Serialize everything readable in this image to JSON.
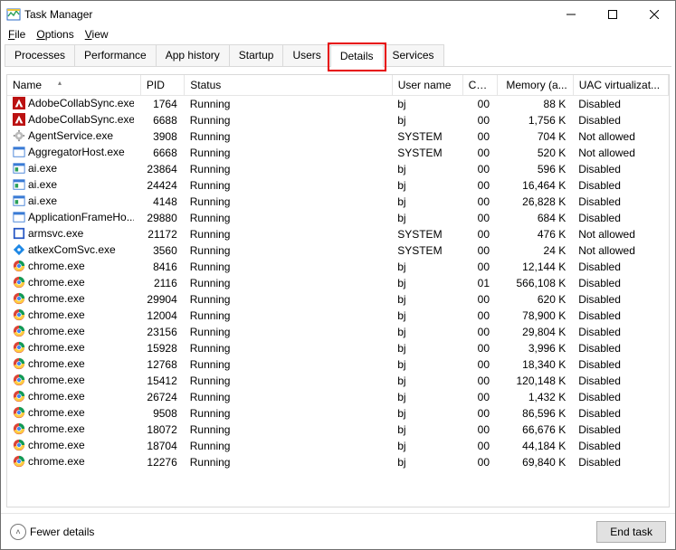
{
  "window": {
    "title": "Task Manager"
  },
  "menu": {
    "file": "File",
    "options": "Options",
    "view": "View"
  },
  "tabs": {
    "processes": "Processes",
    "performance": "Performance",
    "app_history": "App history",
    "startup": "Startup",
    "users": "Users",
    "details": "Details",
    "services": "Services"
  },
  "columns": {
    "name": "Name",
    "pid": "PID",
    "status": "Status",
    "user": "User name",
    "cpu": "CPU",
    "mem": "Memory (a...",
    "uac": "UAC virtualizat..."
  },
  "footer": {
    "fewer": "Fewer details",
    "endtask": "End task"
  },
  "processes": [
    {
      "icon": "adobe",
      "name": "AdobeCollabSync.exe",
      "pid": "1764",
      "status": "Running",
      "user": "bj",
      "cpu": "00",
      "mem": "88 K",
      "uac": "Disabled"
    },
    {
      "icon": "adobe",
      "name": "AdobeCollabSync.exe",
      "pid": "6688",
      "status": "Running",
      "user": "bj",
      "cpu": "00",
      "mem": "1,756 K",
      "uac": "Disabled"
    },
    {
      "icon": "gear",
      "name": "AgentService.exe",
      "pid": "3908",
      "status": "Running",
      "user": "SYSTEM",
      "cpu": "00",
      "mem": "704 K",
      "uac": "Not allowed"
    },
    {
      "icon": "app",
      "name": "AggregatorHost.exe",
      "pid": "6668",
      "status": "Running",
      "user": "SYSTEM",
      "cpu": "00",
      "mem": "520 K",
      "uac": "Not allowed"
    },
    {
      "icon": "ai",
      "name": "ai.exe",
      "pid": "23864",
      "status": "Running",
      "user": "bj",
      "cpu": "00",
      "mem": "596 K",
      "uac": "Disabled"
    },
    {
      "icon": "ai",
      "name": "ai.exe",
      "pid": "24424",
      "status": "Running",
      "user": "bj",
      "cpu": "00",
      "mem": "16,464 K",
      "uac": "Disabled"
    },
    {
      "icon": "ai",
      "name": "ai.exe",
      "pid": "4148",
      "status": "Running",
      "user": "bj",
      "cpu": "00",
      "mem": "26,828 K",
      "uac": "Disabled"
    },
    {
      "icon": "app",
      "name": "ApplicationFrameHo...",
      "pid": "29880",
      "status": "Running",
      "user": "bj",
      "cpu": "00",
      "mem": "684 K",
      "uac": "Disabled"
    },
    {
      "icon": "armsvc",
      "name": "armsvc.exe",
      "pid": "21172",
      "status": "Running",
      "user": "SYSTEM",
      "cpu": "00",
      "mem": "476 K",
      "uac": "Not allowed"
    },
    {
      "icon": "atkex",
      "name": "atkexComSvc.exe",
      "pid": "3560",
      "status": "Running",
      "user": "SYSTEM",
      "cpu": "00",
      "mem": "24 K",
      "uac": "Not allowed"
    },
    {
      "icon": "chrome",
      "name": "chrome.exe",
      "pid": "8416",
      "status": "Running",
      "user": "bj",
      "cpu": "00",
      "mem": "12,144 K",
      "uac": "Disabled"
    },
    {
      "icon": "chrome",
      "name": "chrome.exe",
      "pid": "2116",
      "status": "Running",
      "user": "bj",
      "cpu": "01",
      "mem": "566,108 K",
      "uac": "Disabled"
    },
    {
      "icon": "chrome",
      "name": "chrome.exe",
      "pid": "29904",
      "status": "Running",
      "user": "bj",
      "cpu": "00",
      "mem": "620 K",
      "uac": "Disabled"
    },
    {
      "icon": "chrome",
      "name": "chrome.exe",
      "pid": "12004",
      "status": "Running",
      "user": "bj",
      "cpu": "00",
      "mem": "78,900 K",
      "uac": "Disabled"
    },
    {
      "icon": "chrome",
      "name": "chrome.exe",
      "pid": "23156",
      "status": "Running",
      "user": "bj",
      "cpu": "00",
      "mem": "29,804 K",
      "uac": "Disabled"
    },
    {
      "icon": "chrome",
      "name": "chrome.exe",
      "pid": "15928",
      "status": "Running",
      "user": "bj",
      "cpu": "00",
      "mem": "3,996 K",
      "uac": "Disabled"
    },
    {
      "icon": "chrome",
      "name": "chrome.exe",
      "pid": "12768",
      "status": "Running",
      "user": "bj",
      "cpu": "00",
      "mem": "18,340 K",
      "uac": "Disabled"
    },
    {
      "icon": "chrome",
      "name": "chrome.exe",
      "pid": "15412",
      "status": "Running",
      "user": "bj",
      "cpu": "00",
      "mem": "120,148 K",
      "uac": "Disabled"
    },
    {
      "icon": "chrome",
      "name": "chrome.exe",
      "pid": "26724",
      "status": "Running",
      "user": "bj",
      "cpu": "00",
      "mem": "1,432 K",
      "uac": "Disabled"
    },
    {
      "icon": "chrome",
      "name": "chrome.exe",
      "pid": "9508",
      "status": "Running",
      "user": "bj",
      "cpu": "00",
      "mem": "86,596 K",
      "uac": "Disabled"
    },
    {
      "icon": "chrome",
      "name": "chrome.exe",
      "pid": "18072",
      "status": "Running",
      "user": "bj",
      "cpu": "00",
      "mem": "66,676 K",
      "uac": "Disabled"
    },
    {
      "icon": "chrome",
      "name": "chrome.exe",
      "pid": "18704",
      "status": "Running",
      "user": "bj",
      "cpu": "00",
      "mem": "44,184 K",
      "uac": "Disabled"
    },
    {
      "icon": "chrome",
      "name": "chrome.exe",
      "pid": "12276",
      "status": "Running",
      "user": "bj",
      "cpu": "00",
      "mem": "69,840 K",
      "uac": "Disabled"
    }
  ]
}
